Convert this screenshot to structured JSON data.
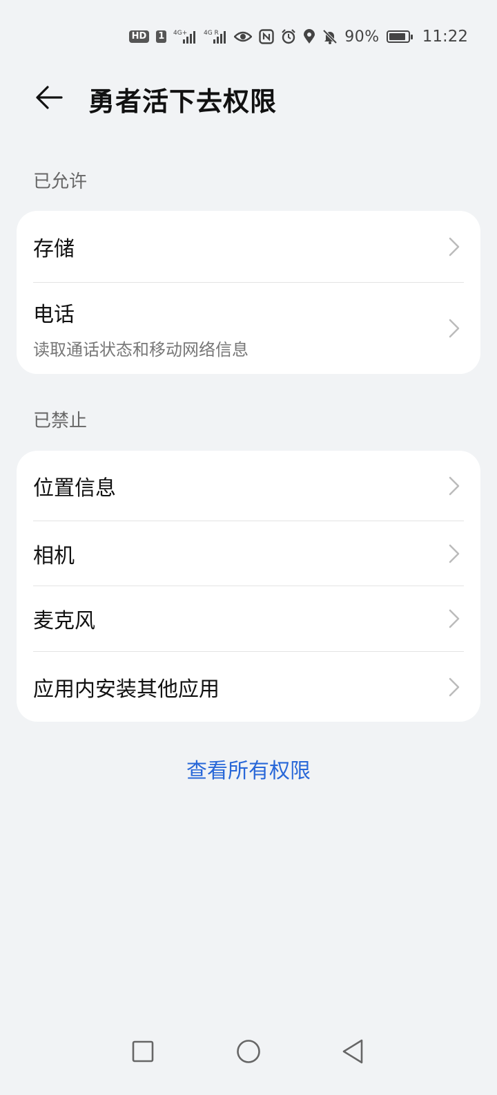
{
  "status_bar": {
    "hd": "HD",
    "sim": "1",
    "net1": "4G+",
    "net2": "4G R",
    "battery_percent": "90%",
    "battery_level": 0.9,
    "time": "11:22",
    "icons": [
      "signal-icon",
      "eye-icon",
      "nfc-icon",
      "alarm-icon",
      "location-icon",
      "mute-icon",
      "battery-icon"
    ]
  },
  "header": {
    "title": "勇者活下去权限"
  },
  "allowed": {
    "label": "已允许",
    "items": [
      {
        "title": "存储",
        "subtitle": ""
      },
      {
        "title": "电话",
        "subtitle": "读取通话状态和移动网络信息"
      }
    ]
  },
  "denied": {
    "label": "已禁止",
    "items": [
      {
        "title": "位置信息"
      },
      {
        "title": "相机"
      },
      {
        "title": "麦克风"
      },
      {
        "title": "应用内安装其他应用"
      }
    ]
  },
  "view_all_link": "查看所有权限",
  "colors": {
    "background": "#f1f3f5",
    "card": "#ffffff",
    "accent": "#2867d8"
  }
}
